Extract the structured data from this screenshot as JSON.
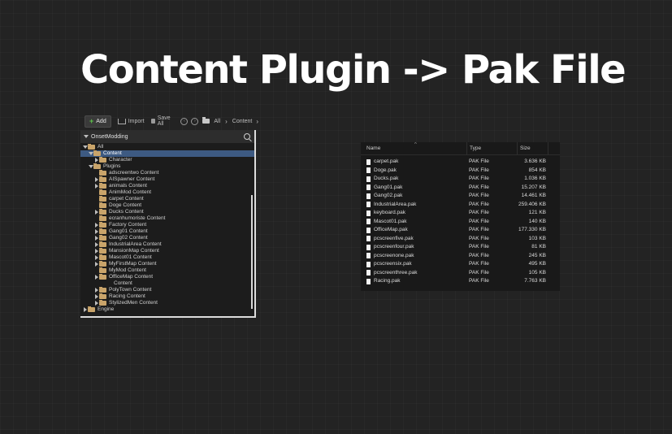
{
  "title": "Content Plugin -> Pak File",
  "toolbar": {
    "add": "Add",
    "import": "Import",
    "save_all": "Save All",
    "all": "All",
    "content": "Content"
  },
  "tree_panel": {
    "header": "OnsetModding",
    "items": [
      {
        "label": "All",
        "depth": 0,
        "expander": "down"
      },
      {
        "label": "Content",
        "depth": 1,
        "expander": "down",
        "selected": true
      },
      {
        "label": "Character",
        "depth": 2,
        "expander": "right"
      },
      {
        "label": "Plugins",
        "depth": 1,
        "expander": "down"
      },
      {
        "label": "adscreentwo Content",
        "depth": 2,
        "expander": "none"
      },
      {
        "label": "AISpawner Content",
        "depth": 2,
        "expander": "right"
      },
      {
        "label": "animals Content",
        "depth": 2,
        "expander": "right"
      },
      {
        "label": "AnimMod Content",
        "depth": 2,
        "expander": "none"
      },
      {
        "label": "carpet Content",
        "depth": 2,
        "expander": "none"
      },
      {
        "label": "Doge Content",
        "depth": 2,
        "expander": "none"
      },
      {
        "label": "Ducks Content",
        "depth": 2,
        "expander": "right"
      },
      {
        "label": "ecranhumoriste Content",
        "depth": 2,
        "expander": "none"
      },
      {
        "label": "Factory Content",
        "depth": 2,
        "expander": "right"
      },
      {
        "label": "Gang01 Content",
        "depth": 2,
        "expander": "right"
      },
      {
        "label": "Gang02 Content",
        "depth": 2,
        "expander": "right"
      },
      {
        "label": "IndustrialArea Content",
        "depth": 2,
        "expander": "right"
      },
      {
        "label": "MansionMap Content",
        "depth": 2,
        "expander": "right"
      },
      {
        "label": "Mascot01 Content",
        "depth": 2,
        "expander": "right"
      },
      {
        "label": "MyFirstMap Content",
        "depth": 2,
        "expander": "right"
      },
      {
        "label": "MyMod Content",
        "depth": 2,
        "expander": "none"
      },
      {
        "label": "OfficeMap Content",
        "depth": 2,
        "expander": "right"
      },
      {
        "label": "Content",
        "depth": 2,
        "expander": "none",
        "indent_extra": true,
        "no_folder": true
      },
      {
        "label": "PolyTown Content",
        "depth": 2,
        "expander": "right"
      },
      {
        "label": "Racing Content",
        "depth": 2,
        "expander": "right"
      },
      {
        "label": "StylizedMen Content",
        "depth": 2,
        "expander": "right"
      },
      {
        "label": "Engine",
        "depth": 0,
        "expander": "right"
      }
    ]
  },
  "explorer": {
    "columns": {
      "name": "Name",
      "type": "Type",
      "size": "Size"
    },
    "files": [
      {
        "name": "carpet.pak",
        "type": "PAK File",
        "size": "3.636 KB"
      },
      {
        "name": "Doge.pak",
        "type": "PAK File",
        "size": "854 KB"
      },
      {
        "name": "Ducks.pak",
        "type": "PAK File",
        "size": "1.036 KB"
      },
      {
        "name": "Gang01.pak",
        "type": "PAK File",
        "size": "15.207 KB"
      },
      {
        "name": "Gang02.pak",
        "type": "PAK File",
        "size": "14.461 KB"
      },
      {
        "name": "IndustrialArea.pak",
        "type": "PAK File",
        "size": "259.406 KB"
      },
      {
        "name": "keyboard.pak",
        "type": "PAK File",
        "size": "121 KB"
      },
      {
        "name": "Mascot01.pak",
        "type": "PAK File",
        "size": "140 KB"
      },
      {
        "name": "OfficeMap.pak",
        "type": "PAK File",
        "size": "177.330 KB"
      },
      {
        "name": "pcscreenfive.pak",
        "type": "PAK File",
        "size": "103 KB"
      },
      {
        "name": "pcscreenfour.pak",
        "type": "PAK File",
        "size": "81 KB"
      },
      {
        "name": "pcscreenone.pak",
        "type": "PAK File",
        "size": "245 KB"
      },
      {
        "name": "pcscreensix.pak",
        "type": "PAK File",
        "size": "495 KB"
      },
      {
        "name": "pcscreenthree.pak",
        "type": "PAK File",
        "size": "105 KB"
      },
      {
        "name": "Racing.pak",
        "type": "PAK File",
        "size": "7.763 KB"
      }
    ]
  },
  "colors": {
    "background": "#232323",
    "selection": "#3d5a82",
    "folder": "#c9a46a",
    "add_plus": "#5ec34b"
  }
}
